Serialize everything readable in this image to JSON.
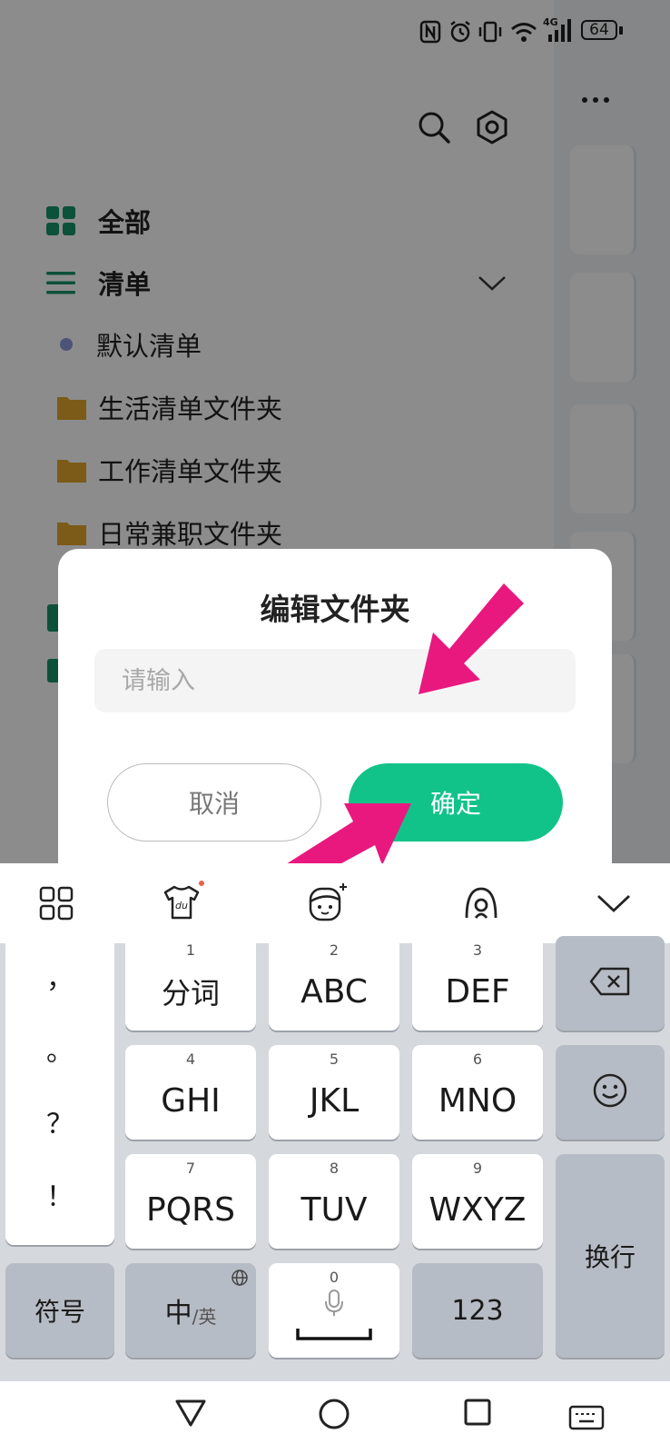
{
  "status_bar": {
    "network": "4G",
    "battery": "64",
    "icons": [
      "nfc-icon",
      "alarm-icon",
      "vibrate-icon",
      "wifi-icon",
      "signal-icon",
      "battery-icon"
    ]
  },
  "sidebar": {
    "items": [
      {
        "label": "全部",
        "icon": "grid-icon"
      },
      {
        "label": "清单",
        "icon": "list-icon"
      },
      {
        "label": "默认清单",
        "icon": "dot-icon"
      },
      {
        "label": "生活清单文件夹",
        "icon": "folder-icon"
      },
      {
        "label": "工作清单文件夹",
        "icon": "folder-icon"
      },
      {
        "label": "日常兼职文件夹",
        "icon": "folder-icon"
      }
    ]
  },
  "dialog": {
    "title": "编辑文件夹",
    "input_placeholder": "请输入",
    "input_value": "",
    "cancel_label": "取消",
    "confirm_label": "确定"
  },
  "keyboard": {
    "toolbar_icons": [
      "grid-menu-icon",
      "skin-du-icon",
      "emoji-sticker-icon",
      "voice-assistant-icon",
      "collapse-keyboard-icon"
    ],
    "punctuation": [
      "，",
      "。",
      "？",
      "！"
    ],
    "keys": [
      {
        "num": "1",
        "label": "分词"
      },
      {
        "num": "2",
        "label": "ABC"
      },
      {
        "num": "3",
        "label": "DEF"
      },
      {
        "num": "4",
        "label": "GHI"
      },
      {
        "num": "5",
        "label": "JKL"
      },
      {
        "num": "6",
        "label": "MNO"
      },
      {
        "num": "7",
        "label": "PQRS"
      },
      {
        "num": "8",
        "label": "TUV"
      },
      {
        "num": "9",
        "label": "WXYZ"
      }
    ],
    "symbol_label": "符号",
    "lang_main": "中",
    "lang_alt": "/英",
    "space_num": "0",
    "num_label": "123",
    "enter_label": "换行"
  },
  "colors": {
    "accent": "#12c389",
    "arrow": "#e8187f",
    "folder": "#e0a62a",
    "nav_icon": "#16946a"
  }
}
